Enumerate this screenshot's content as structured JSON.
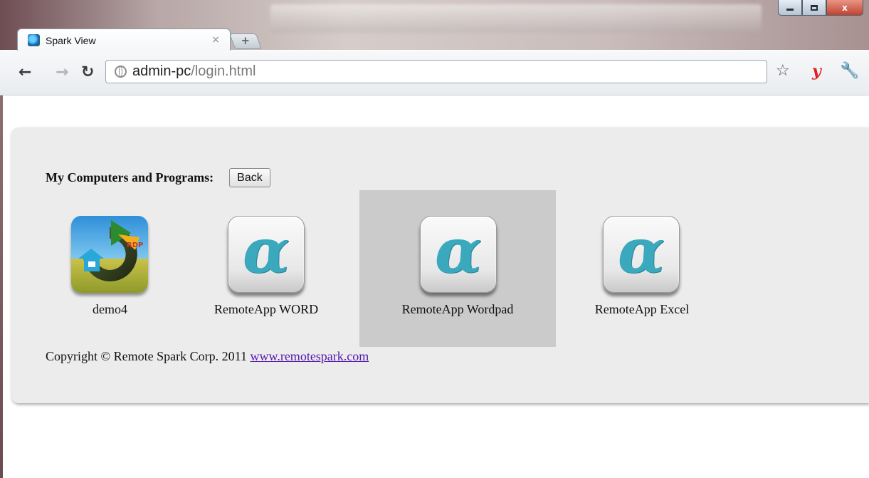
{
  "browser": {
    "tab_title": "Spark View",
    "tab_close": "×",
    "new_tab": "+",
    "url_host": "admin-pc",
    "url_path": "/login.html",
    "window_controls": {
      "close": "x"
    },
    "icons": {
      "back": "arrow-left-icon",
      "forward": "arrow-right-icon",
      "reload": "reload-icon",
      "star": "star-icon",
      "yandex": "y",
      "wrench": "wrench-icon"
    }
  },
  "page": {
    "heading": "My Computers and Programs:",
    "back_button": "Back",
    "apps": [
      {
        "label": "demo4",
        "icon": "rdp-icon",
        "selected": false
      },
      {
        "label": "RemoteApp WORD",
        "icon": "alpha-icon",
        "selected": false
      },
      {
        "label": "RemoteApp Wordpad",
        "icon": "alpha-icon",
        "selected": true
      },
      {
        "label": "RemoteApp Excel",
        "icon": "alpha-icon",
        "selected": false
      }
    ],
    "copyright_text": "Copyright © Remote Spark Corp. 2011",
    "copyright_link": "www.remotespark.com"
  },
  "colors": {
    "panel_bg": "#ececec",
    "selected_bg": "#cbcbcb",
    "link": "#5518ab",
    "alpha_glyph": "#3aa8bd"
  }
}
